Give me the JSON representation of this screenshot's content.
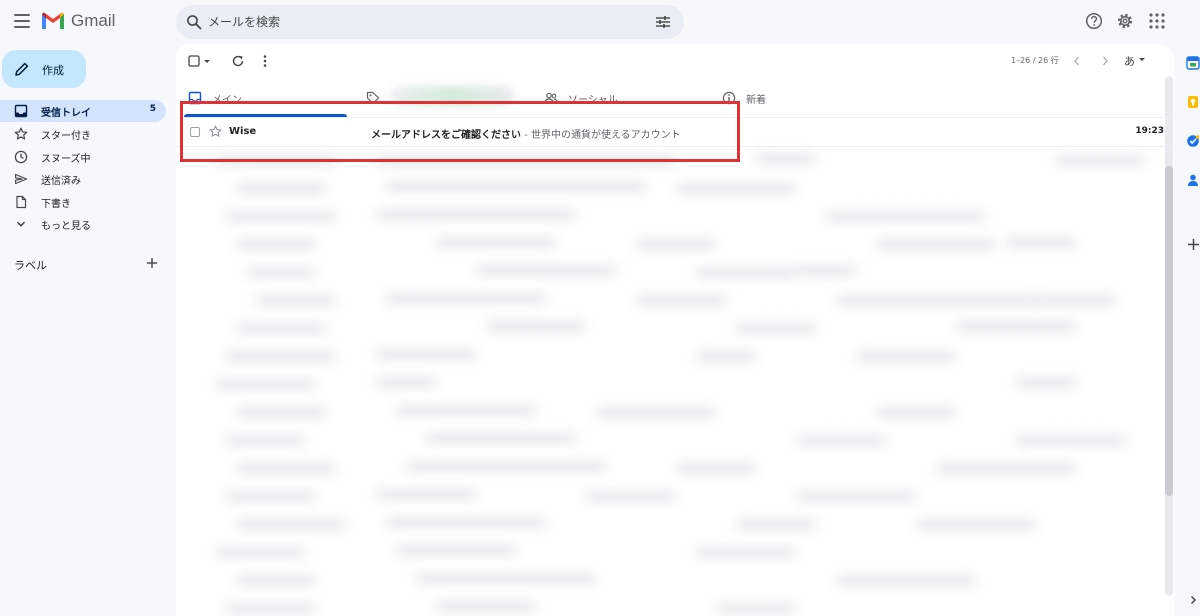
{
  "app": {
    "brand": "Gmail"
  },
  "search": {
    "placeholder": "メールを検索"
  },
  "compose": {
    "label": "作成"
  },
  "nav": [
    {
      "label": "受信トレイ",
      "count": "5",
      "icon": "inbox-icon",
      "active": true
    },
    {
      "label": "スター付き",
      "icon": "star-icon"
    },
    {
      "label": "スヌーズ中",
      "icon": "clock-icon"
    },
    {
      "label": "送信済み",
      "icon": "send-icon"
    },
    {
      "label": "下書き",
      "icon": "draft-icon"
    },
    {
      "label": "もっと見る",
      "icon": "chevron-down-icon"
    }
  ],
  "labels": {
    "title": "ラベル"
  },
  "toolbar": {
    "range": "1–26 / 26 行",
    "input_tool": "あ"
  },
  "tabs": [
    {
      "label": "メイン",
      "icon": "inbox-icon"
    },
    {
      "label": "ソーシャル",
      "icon": "people-icon"
    },
    {
      "label": "新着",
      "icon": "info-icon"
    }
  ],
  "email": {
    "sender": "Wise",
    "subject": "メールアドレスをご確認ください",
    "snippet": " - 世界中の通貨が使えるアカウント",
    "time": "19:23"
  },
  "colors": {
    "accent": "#0b57d0",
    "compose_bg": "#c2e7ff",
    "active_nav": "#d3e3fd",
    "highlight": "#e03232"
  }
}
